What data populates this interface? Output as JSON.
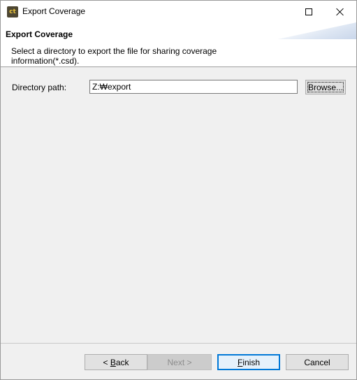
{
  "window": {
    "title": "Export Coverage",
    "icon": "ct-app-icon",
    "icon_glyph": "ct"
  },
  "banner": {
    "title": "Export Coverage",
    "description": "Select a directory to export the file for sharing coverage information(*.csd)."
  },
  "form": {
    "directory_label": "Directory path:",
    "directory_value": "Z:₩export",
    "browse_label": "Browse..."
  },
  "buttons": {
    "back_prefix": "< ",
    "back_mnemonic": "B",
    "back_rest": "ack",
    "next_label": "Next >",
    "finish_mnemonic": "F",
    "finish_rest": "inish",
    "cancel_label": "Cancel"
  },
  "colors": {
    "focus_border": "#0078d7",
    "disabled_text": "#8d8d8d"
  }
}
